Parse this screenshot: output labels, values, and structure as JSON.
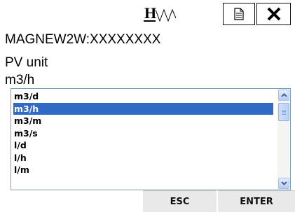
{
  "header": {
    "logo_text": "HW",
    "doc_icon": "document-icon",
    "close_icon": "close-icon"
  },
  "device": {
    "tag": "MAGNEW2W:XXXXXXXX"
  },
  "parameter": {
    "name": "PV unit",
    "current_value": "m3/h"
  },
  "units_list": {
    "items": [
      "m3/d",
      "m3/h",
      "m3/m",
      "m3/s",
      "l/d",
      "l/h",
      "l/m"
    ],
    "selected": "m3/h"
  },
  "buttons": {
    "esc_label": "ESC",
    "enter_label": "ENTER"
  },
  "colors": {
    "selection": "#316ac5",
    "button_bar": "#e9e9e9"
  }
}
